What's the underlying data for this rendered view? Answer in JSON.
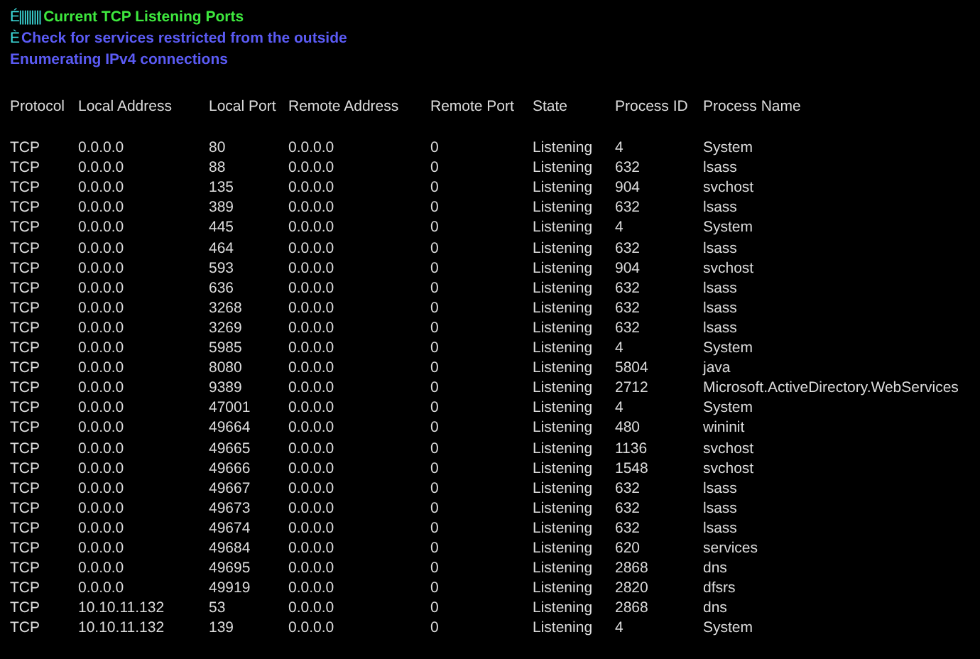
{
  "header_lines": [
    {
      "prefix": "É|||||||||",
      "text": "Current TCP Listening Ports",
      "color": "#3ee83e"
    },
    {
      "prefix": "È",
      "text": "Check for services restricted from the outside",
      "color": "#5b5bf5"
    },
    {
      "text": "Enumerating IPv4 connections",
      "color": "#5b5bf5"
    }
  ],
  "table": {
    "columns": [
      "Protocol",
      "Local Address",
      "Local Port",
      "Remote Address",
      "Remote Port",
      "State",
      "Process ID",
      "Process Name"
    ],
    "rows": [
      [
        "TCP",
        "0.0.0.0",
        "80",
        "0.0.0.0",
        "0",
        "Listening",
        "4",
        "System"
      ],
      [
        "TCP",
        "0.0.0.0",
        "88",
        "0.0.0.0",
        "0",
        "Listening",
        "632",
        "lsass"
      ],
      [
        "TCP",
        "0.0.0.0",
        "135",
        "0.0.0.0",
        "0",
        "Listening",
        "904",
        "svchost"
      ],
      [
        "TCP",
        "0.0.0.0",
        "389",
        "0.0.0.0",
        "0",
        "Listening",
        "632",
        "lsass"
      ],
      [
        "TCP",
        "0.0.0.0",
        "445",
        "0.0.0.0",
        "0",
        "Listening",
        "4",
        "System"
      ],
      [
        "TCP",
        "0.0.0.0",
        "464",
        "0.0.0.0",
        "0",
        "Listening",
        "632",
        "lsass"
      ],
      [
        "TCP",
        "0.0.0.0",
        "593",
        "0.0.0.0",
        "0",
        "Listening",
        "904",
        "svchost"
      ],
      [
        "TCP",
        "0.0.0.0",
        "636",
        "0.0.0.0",
        "0",
        "Listening",
        "632",
        "lsass"
      ],
      [
        "TCP",
        "0.0.0.0",
        "3268",
        "0.0.0.0",
        "0",
        "Listening",
        "632",
        "lsass"
      ],
      [
        "TCP",
        "0.0.0.0",
        "3269",
        "0.0.0.0",
        "0",
        "Listening",
        "632",
        "lsass"
      ],
      [
        "TCP",
        "0.0.0.0",
        "5985",
        "0.0.0.0",
        "0",
        "Listening",
        "4",
        "System"
      ],
      [
        "TCP",
        "0.0.0.0",
        "8080",
        "0.0.0.0",
        "0",
        "Listening",
        "5804",
        "java"
      ],
      [
        "TCP",
        "0.0.0.0",
        "9389",
        "0.0.0.0",
        "0",
        "Listening",
        "2712",
        "Microsoft.ActiveDirectory.WebServices"
      ],
      [
        "TCP",
        "0.0.0.0",
        "47001",
        "0.0.0.0",
        "0",
        "Listening",
        "4",
        "System"
      ],
      [
        "TCP",
        "0.0.0.0",
        "49664",
        "0.0.0.0",
        "0",
        "Listening",
        "480",
        "wininit"
      ],
      [
        "TCP",
        "0.0.0.0",
        "49665",
        "0.0.0.0",
        "0",
        "Listening",
        "1136",
        "svchost"
      ],
      [
        "TCP",
        "0.0.0.0",
        "49666",
        "0.0.0.0",
        "0",
        "Listening",
        "1548",
        "svchost"
      ],
      [
        "TCP",
        "0.0.0.0",
        "49667",
        "0.0.0.0",
        "0",
        "Listening",
        "632",
        "lsass"
      ],
      [
        "TCP",
        "0.0.0.0",
        "49673",
        "0.0.0.0",
        "0",
        "Listening",
        "632",
        "lsass"
      ],
      [
        "TCP",
        "0.0.0.0",
        "49674",
        "0.0.0.0",
        "0",
        "Listening",
        "632",
        "lsass"
      ],
      [
        "TCP",
        "0.0.0.0",
        "49684",
        "0.0.0.0",
        "0",
        "Listening",
        "620",
        "services"
      ],
      [
        "TCP",
        "0.0.0.0",
        "49695",
        "0.0.0.0",
        "0",
        "Listening",
        "2868",
        "dns"
      ],
      [
        "TCP",
        "0.0.0.0",
        "49919",
        "0.0.0.0",
        "0",
        "Listening",
        "2820",
        "dfsrs"
      ],
      [
        "TCP",
        "10.10.11.132",
        "53",
        "0.0.0.0",
        "0",
        "Listening",
        "2868",
        "dns"
      ],
      [
        "TCP",
        "10.10.11.132",
        "139",
        "0.0.0.0",
        "0",
        "Listening",
        "4",
        "System"
      ]
    ]
  }
}
